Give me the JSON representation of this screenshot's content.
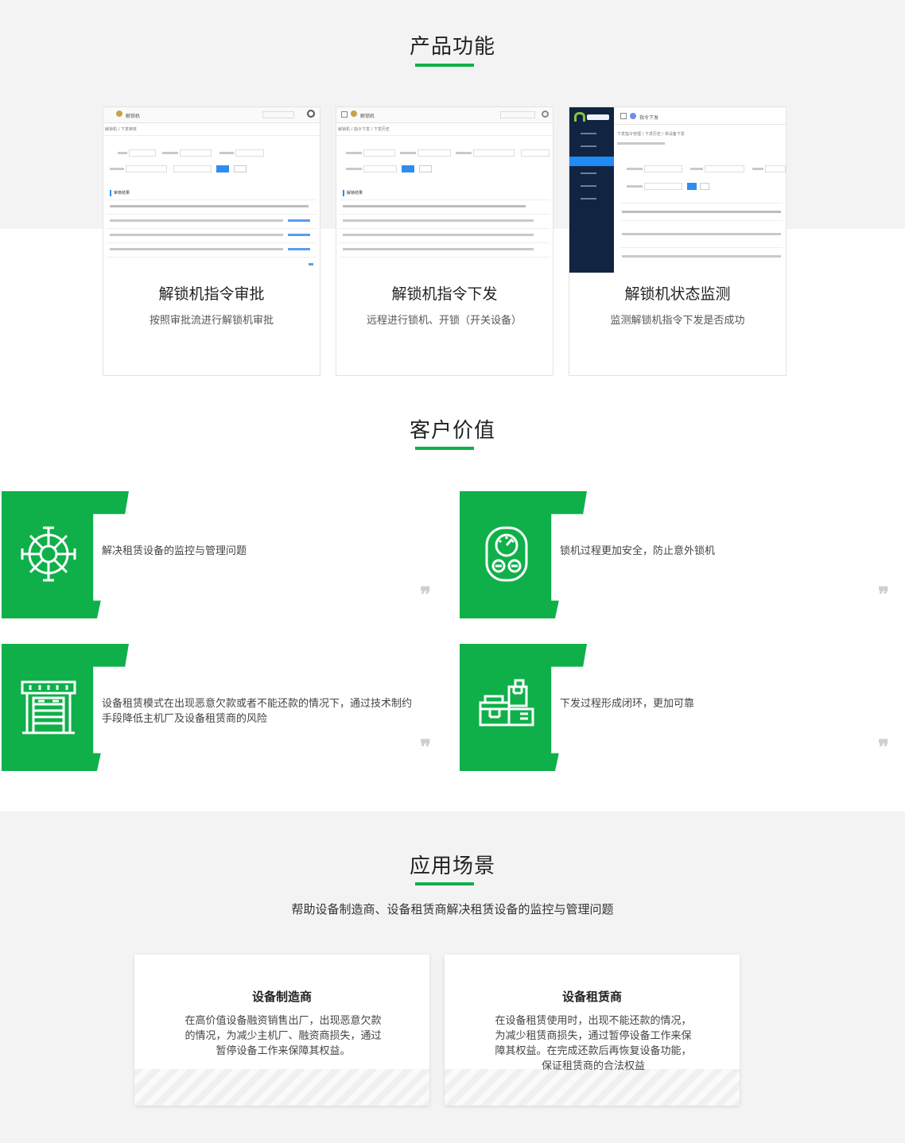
{
  "features": {
    "title": "产品功能",
    "cards": [
      {
        "title": "解锁机指令审批",
        "desc": "按照审批流进行解锁机审批",
        "screen": {
          "header": "解锁机",
          "crumb": "解锁机 / 下发审核",
          "section": "审核结果"
        }
      },
      {
        "title": "解锁机指令下发",
        "desc": "远程进行锁机、开锁（开关设备）",
        "screen": {
          "header": "解锁机",
          "crumb": "解锁机 / 指令下发 / 下发历史",
          "section": "解锁结果"
        }
      },
      {
        "title": "解锁机状态监测",
        "desc": "监测解锁机指令下发是否成功",
        "screen": {
          "header": "指令下发",
          "crumb": "下发指令管理 / 下发历史 / 单设备下发"
        }
      }
    ]
  },
  "values": {
    "title": "客户价值",
    "items": [
      {
        "icon": "gear-wheel-icon",
        "text": "解决租赁设备的监控与管理问题"
      },
      {
        "icon": "gauge-device-icon",
        "text": "锁机过程更加安全，防止意外锁机"
      },
      {
        "icon": "warehouse-icon",
        "text": "设备租赁模式在出现恶意欠款或者不能还款的情况下，通过技术制约手段降低主机厂及设备租赁商的风险"
      },
      {
        "icon": "boxes-icon",
        "text": "下发过程形成闭环，更加可靠"
      }
    ],
    "quote_mark": "❞"
  },
  "scenarios": {
    "title": "应用场景",
    "subtitle": "帮助设备制造商、设备租赁商解决租赁设备的监控与管理问题",
    "cards": [
      {
        "title": "设备制造商",
        "desc": "在高价值设备融资销售出厂，出现恶意欠款的情况，为减少主机厂、融资商损失，通过暂停设备工作来保障其权益。"
      },
      {
        "title": "设备租赁商",
        "desc": "在设备租赁使用时，出现不能还款的情况，为减少租赁商损失，通过暂停设备工作来保障其权益。在完成还款后再恢复设备功能，保证租赁商的合法权益"
      }
    ]
  },
  "colors": {
    "accent": "#0fb04a",
    "section_bg": "#f3f3f3"
  }
}
